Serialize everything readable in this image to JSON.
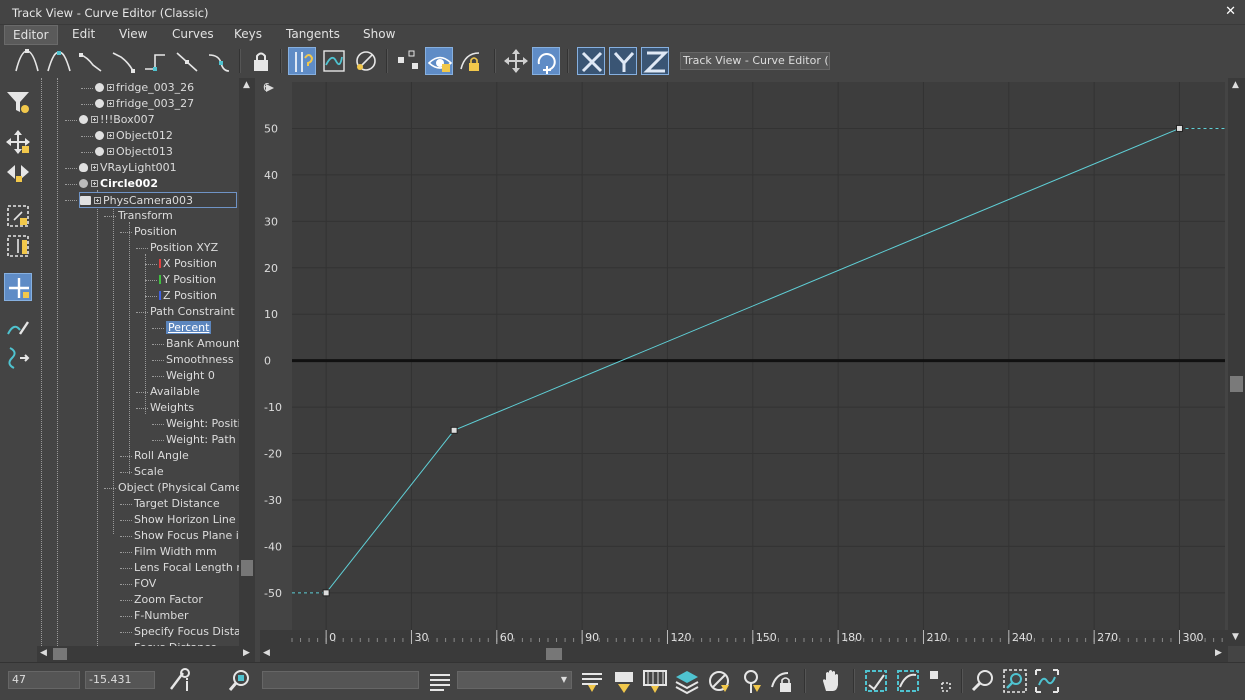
{
  "window": {
    "title": "Track View - Curve Editor (Classic)",
    "close_glyph": "✕"
  },
  "menu": [
    "Editor",
    "Edit",
    "View",
    "Curves",
    "Keys",
    "Tangents",
    "Show"
  ],
  "toolbar": {
    "name_field": "Track View - Curve Editor (Classic)"
  },
  "tree": [
    {
      "label": "fridge_003_26",
      "indent": 58,
      "icon": "dot",
      "expander": "plus"
    },
    {
      "label": "fridge_003_27",
      "indent": 58,
      "icon": "dot",
      "expander": "plus"
    },
    {
      "label": "!!!Box007",
      "indent": 42,
      "icon": "dot",
      "expander": "plus"
    },
    {
      "label": "Object012",
      "indent": 58,
      "icon": "dot",
      "expander": "plus"
    },
    {
      "label": "Object013",
      "indent": 58,
      "icon": "dot",
      "expander": "plus"
    },
    {
      "label": "VRayLight001",
      "indent": 42,
      "icon": "bulb",
      "expander": "plus"
    },
    {
      "label": "Circle002",
      "indent": 42,
      "icon": "shape",
      "expander": "plus",
      "bold": true
    },
    {
      "label": "PhysCamera003",
      "indent": 42,
      "icon": "camera",
      "expander": "minus",
      "boxed": true
    },
    {
      "label": "Transform",
      "indent": 81
    },
    {
      "label": "Position",
      "indent": 97
    },
    {
      "label": "Position XYZ",
      "indent": 113
    },
    {
      "label": "X Position",
      "indent": 122,
      "axis": "x"
    },
    {
      "label": "Y Position",
      "indent": 122,
      "axis": "y"
    },
    {
      "label": "Z Position",
      "indent": 122,
      "axis": "z"
    },
    {
      "label": "Path Constraint",
      "indent": 113
    },
    {
      "label": "Percent",
      "indent": 129,
      "selected": true
    },
    {
      "label": "Bank Amount",
      "indent": 129
    },
    {
      "label": "Smoothness",
      "indent": 129
    },
    {
      "label": "Weight 0",
      "indent": 129
    },
    {
      "label": "Available",
      "indent": 113
    },
    {
      "label": "Weights",
      "indent": 113
    },
    {
      "label": "Weight: Position",
      "indent": 129
    },
    {
      "label": "Weight: Path C",
      "indent": 129
    },
    {
      "label": "Roll Angle",
      "indent": 97
    },
    {
      "label": "Scale",
      "indent": 97
    },
    {
      "label": "Object (Physical Camera)",
      "indent": 81
    },
    {
      "label": "Target Distance",
      "indent": 97
    },
    {
      "label": "Show Horizon Line",
      "indent": 97
    },
    {
      "label": "Show Focus Plane in Q",
      "indent": 97
    },
    {
      "label": "Film Width mm",
      "indent": 97
    },
    {
      "label": "Lens Focal Length mm",
      "indent": 97
    },
    {
      "label": "FOV",
      "indent": 97
    },
    {
      "label": "Zoom Factor",
      "indent": 97
    },
    {
      "label": "F-Number",
      "indent": 97
    },
    {
      "label": "Specify Focus Distanc",
      "indent": 97
    },
    {
      "label": "Focus Distance",
      "indent": 97
    }
  ],
  "chart_data": {
    "type": "line",
    "series": [
      {
        "values": [
          [
            0,
            -50
          ],
          [
            45,
            -15
          ],
          [
            300,
            50
          ]
        ]
      }
    ],
    "extrapolation": {
      "before": -50,
      "after": 50
    },
    "xticks": [
      0,
      30,
      60,
      90,
      120,
      150,
      180,
      210,
      240,
      270,
      300
    ],
    "yticks": [
      50,
      40,
      30,
      20,
      10,
      0,
      -10,
      -20,
      -30,
      -40,
      -50
    ],
    "xlim": [
      -12,
      316
    ],
    "ylim": [
      -58,
      60
    ],
    "corner_label": "6",
    "line_color": "#5fcfd6",
    "zero_line_color": "#111111",
    "grid": true
  },
  "status": {
    "frame": "47",
    "value": "-15.431"
  }
}
